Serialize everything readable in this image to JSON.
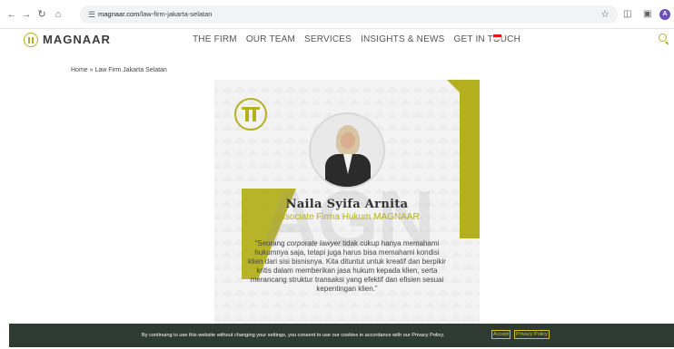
{
  "browser": {
    "url_host": "magnaar.com",
    "url_path": "/law-firm-jakarta-selatan",
    "profile_initial": "A"
  },
  "site": {
    "logo_text": "MAGNAAR",
    "nav": [
      {
        "label": "THE FIRM"
      },
      {
        "label": "OUR TEAM"
      },
      {
        "label": "SERVICES"
      },
      {
        "label": "INSIGHTS & NEWS"
      },
      {
        "label": "GET IN TOUCH"
      }
    ]
  },
  "breadcrumb": {
    "text": "Home » Law Firm Jakarta Selatan"
  },
  "banner": {
    "watermark": "AGN",
    "name": "Naila Syifa Arnita",
    "role": "Associate Firma Hukum MAGNAAR",
    "quote_open": "“Seorang ",
    "quote_em": "corporate lawyer",
    "quote_rest": " tidak cukup hanya memahami hukumnya saja, tetapi juga harus bisa memahami kondisi klien dari sisi bisnisnya. Kita dituntut untuk kreatif dan berpikir kritis dalam memberikan jasa hukum kepada klien, serta merancang struktur transaksi yang efektif dan efisien sesuai kepentingan klien.”"
  },
  "cookie": {
    "message": "By continuing to use this website without changing your settings, you consent to use our cookies in accordance with our Privacy Policy.",
    "accept_label": "Accept",
    "policy_label": "Privacy Policy"
  },
  "colors": {
    "brand_olive": "#b4b01f",
    "cookie_bg": "#2e3b33"
  }
}
